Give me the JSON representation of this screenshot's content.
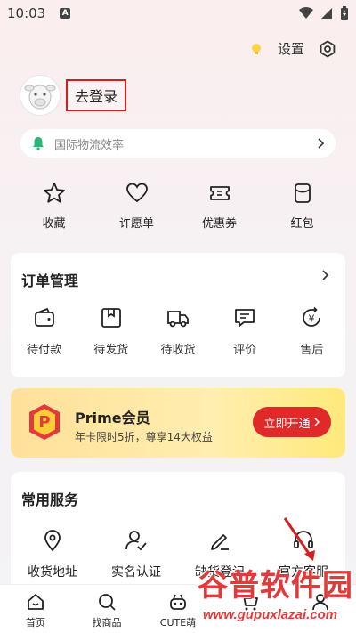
{
  "status_bar": {
    "time": "10:03",
    "a_badge": "A"
  },
  "header": {
    "settings_label": "设置"
  },
  "profile": {
    "login_label": "去登录"
  },
  "notice": {
    "text": "国际物流效率"
  },
  "quick_actions": [
    {
      "label": "收藏",
      "icon": "star-icon"
    },
    {
      "label": "许愿单",
      "icon": "heart-icon"
    },
    {
      "label": "优惠券",
      "icon": "ticket-icon"
    },
    {
      "label": "红包",
      "icon": "red-packet-icon"
    }
  ],
  "orders": {
    "title": "订单管理",
    "items": [
      {
        "label": "待付款",
        "icon": "wallet-icon"
      },
      {
        "label": "待发货",
        "icon": "box-icon"
      },
      {
        "label": "待收货",
        "icon": "truck-icon"
      },
      {
        "label": "评价",
        "icon": "comment-icon"
      },
      {
        "label": "售后",
        "icon": "refund-icon"
      }
    ]
  },
  "prime": {
    "logo_letter": "P",
    "title": "Prime会员",
    "subtitle": "年卡限时5折，尊享14大权益",
    "button": "立即开通"
  },
  "services": {
    "title": "常用服务",
    "items": [
      {
        "label": "收货地址",
        "icon": "location-icon"
      },
      {
        "label": "实名认证",
        "icon": "verified-user-icon"
      },
      {
        "label": "缺货登记",
        "icon": "edit-icon"
      },
      {
        "label": "官方客服",
        "icon": "headset-icon"
      }
    ]
  },
  "tabs": [
    {
      "label": "首页",
      "icon": "home-icon"
    },
    {
      "label": "找商品",
      "icon": "search-icon"
    },
    {
      "label": "CUTE萌",
      "icon": "cute-icon"
    },
    {
      "label": "",
      "icon": "cart-icon"
    },
    {
      "label": "",
      "icon": "profile-icon"
    }
  ],
  "watermark": {
    "cn": "谷普软件园",
    "url": "www.gupuxlazai.com"
  },
  "colors": {
    "accent_red": "#e02a2a",
    "login_outline": "#d41f1f",
    "notice_bell": "#2bb673",
    "prime_gold": "#ffe099"
  }
}
